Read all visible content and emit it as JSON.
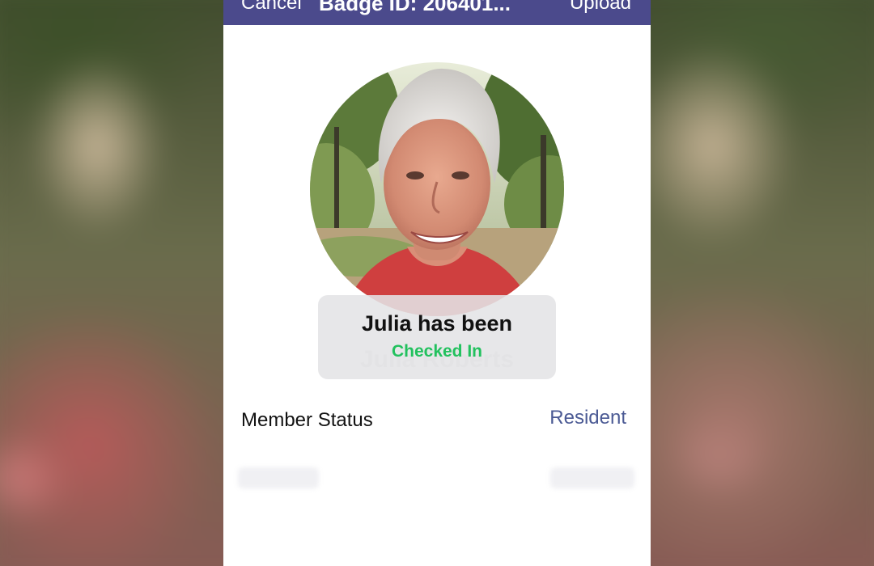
{
  "header": {
    "cancel_label": "Cancel",
    "title": "Badge ID: 206401...",
    "upload_label": "Upload",
    "background_color": "#4b4a8c"
  },
  "member": {
    "name": "Julia Roberts"
  },
  "toast": {
    "line1": "Julia has been",
    "line2": "Checked In",
    "status_color": "#22c15e"
  },
  "details": {
    "status_label": "Member Status",
    "status_value": "Resident"
  }
}
